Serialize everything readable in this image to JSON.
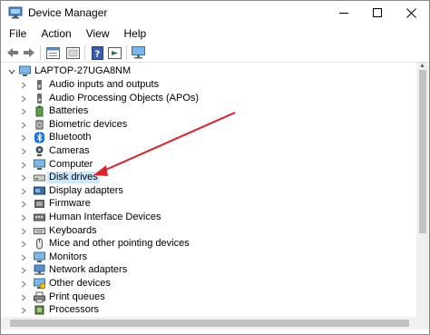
{
  "window": {
    "title": "Device Manager"
  },
  "menu": [
    "File",
    "Action",
    "View",
    "Help"
  ],
  "toolbar": {
    "icons": [
      "back-icon",
      "forward-icon",
      "properties-icon",
      "help-pane-icon",
      "help-icon",
      "scan-icon",
      "monitor-icon"
    ]
  },
  "tree": {
    "root": "LAPTOP-27UGA8NM",
    "items": [
      {
        "label": "Audio inputs and outputs",
        "icon": "speaker-icon"
      },
      {
        "label": "Audio Processing Objects (APOs)",
        "icon": "speaker-icon"
      },
      {
        "label": "Batteries",
        "icon": "battery-icon"
      },
      {
        "label": "Biometric devices",
        "icon": "fingerprint-icon"
      },
      {
        "label": "Bluetooth",
        "icon": "bluetooth-icon"
      },
      {
        "label": "Cameras",
        "icon": "camera-icon"
      },
      {
        "label": "Computer",
        "icon": "computer-icon"
      },
      {
        "label": "Disk drives",
        "icon": "disk-drive-icon"
      },
      {
        "label": "Display adapters",
        "icon": "display-adapter-icon"
      },
      {
        "label": "Firmware",
        "icon": "firmware-icon"
      },
      {
        "label": "Human Interface Devices",
        "icon": "hid-icon"
      },
      {
        "label": "Keyboards",
        "icon": "keyboard-icon"
      },
      {
        "label": "Mice and other pointing devices",
        "icon": "mouse-icon"
      },
      {
        "label": "Monitors",
        "icon": "monitor-icon"
      },
      {
        "label": "Network adapters",
        "icon": "network-icon"
      },
      {
        "label": "Other devices",
        "icon": "other-device-icon"
      },
      {
        "label": "Print queues",
        "icon": "printer-icon"
      },
      {
        "label": "Processors",
        "icon": "processor-icon"
      }
    ],
    "selected": "Disk drives"
  },
  "annotation": {
    "arrow_color": "#e0202a"
  }
}
